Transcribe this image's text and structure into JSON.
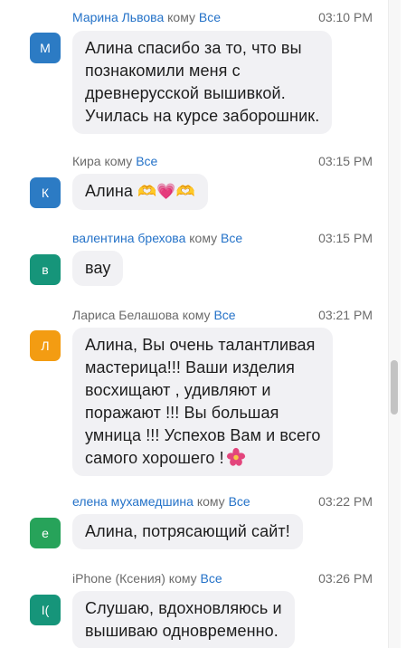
{
  "to_word": "кому",
  "messages": [
    {
      "sender": "Марина Львова",
      "to": "Все",
      "time": "03:10 PM",
      "avatar": "М",
      "avatar_color": "#2c7bc4",
      "lines": [
        "Алина спасибо за то, что вы",
        "познакомили меня с",
        "древнерусской вышивкой.",
        "Училась на курсе заборошник."
      ]
    },
    {
      "sender": "Кира",
      "to": "Все",
      "time": "03:15 PM",
      "avatar": "К",
      "avatar_color": "#2c7bc4",
      "text": "Алина",
      "emoji": "🫶💗🫶"
    },
    {
      "sender": "валентина брехова",
      "to": "Все",
      "time": "03:15 PM",
      "avatar": "в",
      "avatar_color": "#16957a",
      "lines": [
        "вау"
      ]
    },
    {
      "sender": "Лариса Белашова",
      "to": "Все",
      "time": "03:21 PM",
      "avatar": "Л",
      "avatar_color": "#f39c12",
      "lines": [
        "Алина, Вы очень талантливая",
        "мастерица!!! Ваши изделия",
        "восхищают , удивляют и",
        "поражают !!! Вы большая",
        "умница !!! Успехов Вам и всего",
        "самого хорошего !"
      ],
      "trailing_emoji": "flower-icon"
    },
    {
      "sender": "елена мухамедшина",
      "to": "Все",
      "time": "03:22 PM",
      "avatar": "е",
      "avatar_color": "#27a35a",
      "lines": [
        "Алина, потрясающий сайт!"
      ]
    },
    {
      "sender": "iPhone (Ксения)",
      "to": "Все",
      "time": "03:26 PM",
      "avatar": "I(",
      "avatar_color": "#16957a",
      "lines": [
        "Слушаю, вдохновляюсь и",
        "вышиваю одновременно."
      ]
    }
  ]
}
